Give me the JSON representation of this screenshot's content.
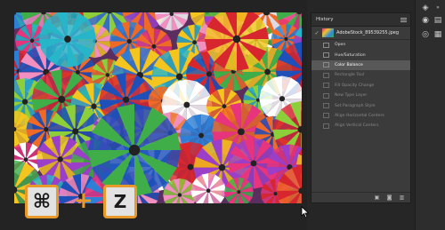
{
  "panel": {
    "title": "History",
    "snapshot": "AdobeStock_89539255.jpeg",
    "states": [
      {
        "label": "Open",
        "status": "done"
      },
      {
        "label": "Hue/Saturation",
        "status": "done"
      },
      {
        "label": "Color Balance",
        "status": "current"
      },
      {
        "label": "Rectangle Tool",
        "status": "undone"
      },
      {
        "label": "Fill Opacity Change",
        "status": "undone"
      },
      {
        "label": "New Type Layer",
        "status": "undone"
      },
      {
        "label": "Set Paragraph Style",
        "status": "undone"
      },
      {
        "label": "Align Horizontal Centers",
        "status": "undone"
      },
      {
        "label": "Align Vertical Centers",
        "status": "undone"
      }
    ]
  },
  "keys": {
    "cmd": "⌘",
    "plus": "+",
    "z": "Z"
  },
  "colors": {
    "accent": "#e79a2a",
    "panel_bg": "#3b3b3b",
    "selected_row": "#585858"
  },
  "icons": {
    "panel_menu": "hamburger-menu-icon",
    "snapshot_brush": "history-brush-icon",
    "footer": [
      "new-document-from-state-icon",
      "camera-icon",
      "trash-icon"
    ],
    "toolbar": [
      "layers-icon",
      "channels-icon",
      "paths-icon",
      "history-icon",
      "properties-icon"
    ]
  }
}
